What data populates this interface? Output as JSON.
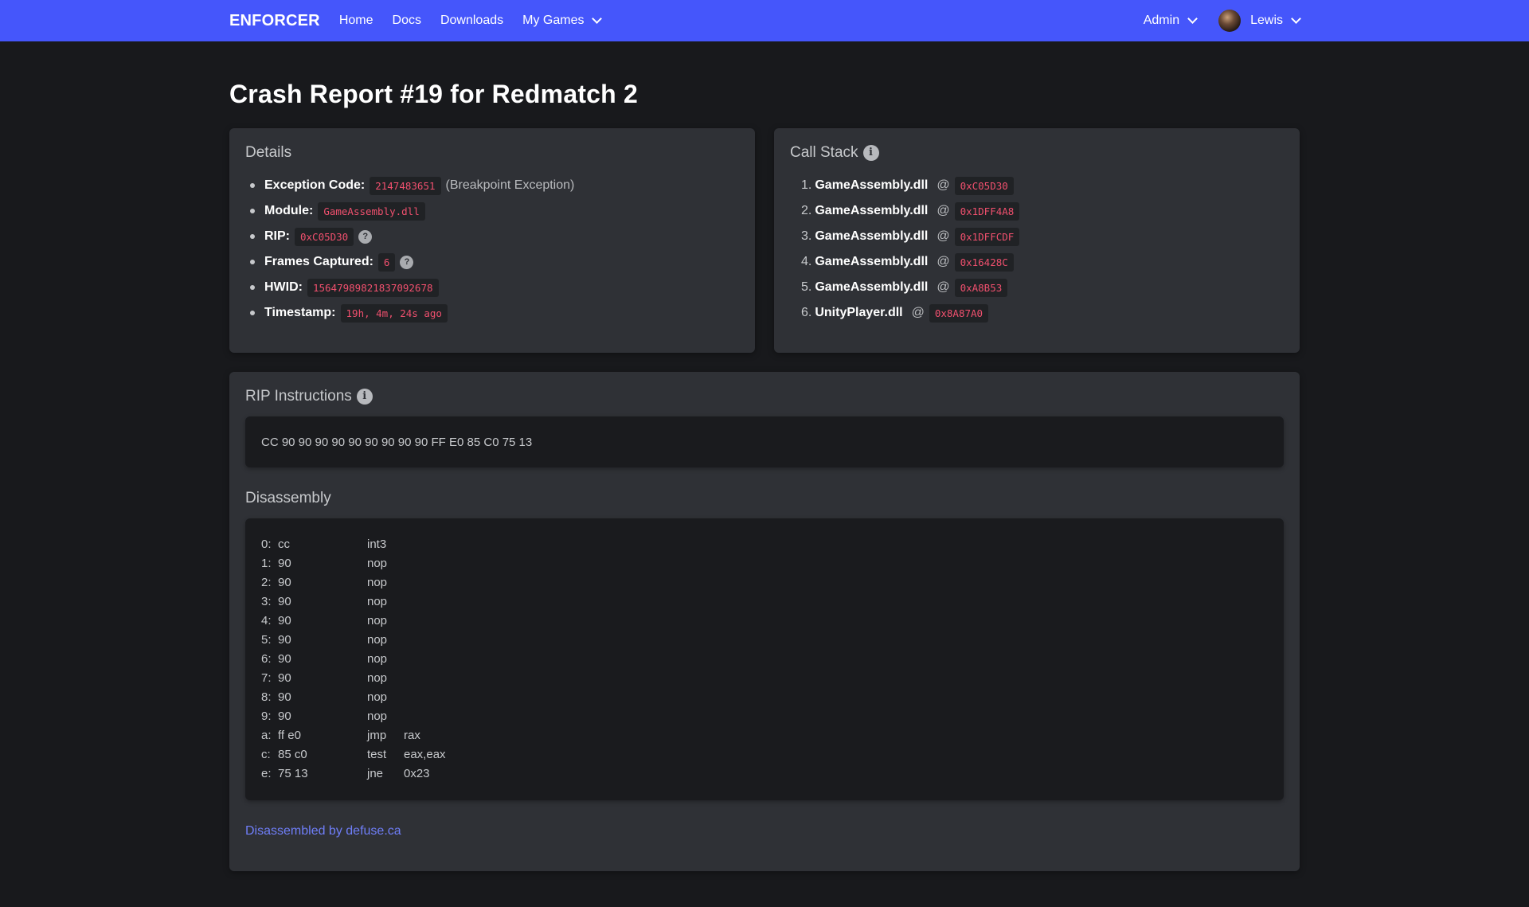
{
  "nav": {
    "brand": "ENFORCER",
    "links": [
      "Home",
      "Docs",
      "Downloads"
    ],
    "my_games": "My Games",
    "admin": "Admin",
    "user": "Lewis"
  },
  "page": {
    "title": "Crash Report #19 for Redmatch 2"
  },
  "details": {
    "title": "Details",
    "exception_label": "Exception Code:",
    "exception_value": "2147483651",
    "exception_desc": "(Breakpoint Exception)",
    "module_label": "Module:",
    "module_value": "GameAssembly.dll",
    "rip_label": "RIP:",
    "rip_value": "0xC05D30",
    "frames_label": "Frames Captured:",
    "frames_value": "6",
    "hwid_label": "HWID:",
    "hwid_value": "15647989821837092678",
    "timestamp_label": "Timestamp:",
    "timestamp_value": "19h, 4m, 24s ago"
  },
  "call_stack": {
    "title": "Call Stack",
    "at": "@",
    "frames": [
      {
        "num": "1.",
        "module": "GameAssembly.dll",
        "addr": "0xC05D30"
      },
      {
        "num": "2.",
        "module": "GameAssembly.dll",
        "addr": "0x1DFF4A8"
      },
      {
        "num": "3.",
        "module": "GameAssembly.dll",
        "addr": "0x1DFFCDF"
      },
      {
        "num": "4.",
        "module": "GameAssembly.dll",
        "addr": "0x16428C"
      },
      {
        "num": "5.",
        "module": "GameAssembly.dll",
        "addr": "0xA8B53"
      },
      {
        "num": "6.",
        "module": "UnityPlayer.dll",
        "addr": "0x8A87A0"
      }
    ]
  },
  "rip_instructions": {
    "title": "RIP Instructions",
    "hex": "CC 90 90 90 90 90 90 90 90 90 FF E0 85 C0 75 13"
  },
  "disassembly": {
    "title": "Disassembly",
    "lines": [
      {
        "addr": "0:",
        "bytes": "cc",
        "mnem": "int3",
        "ops": ""
      },
      {
        "addr": "1:",
        "bytes": "90",
        "mnem": "nop",
        "ops": ""
      },
      {
        "addr": "2:",
        "bytes": "90",
        "mnem": "nop",
        "ops": ""
      },
      {
        "addr": "3:",
        "bytes": "90",
        "mnem": "nop",
        "ops": ""
      },
      {
        "addr": "4:",
        "bytes": "90",
        "mnem": "nop",
        "ops": ""
      },
      {
        "addr": "5:",
        "bytes": "90",
        "mnem": "nop",
        "ops": ""
      },
      {
        "addr": "6:",
        "bytes": "90",
        "mnem": "nop",
        "ops": ""
      },
      {
        "addr": "7:",
        "bytes": "90",
        "mnem": "nop",
        "ops": ""
      },
      {
        "addr": "8:",
        "bytes": "90",
        "mnem": "nop",
        "ops": ""
      },
      {
        "addr": "9:",
        "bytes": "90",
        "mnem": "nop",
        "ops": ""
      },
      {
        "addr": "a:",
        "bytes": "ff e0",
        "mnem": "jmp",
        "ops": "rax"
      },
      {
        "addr": "c:",
        "bytes": "85 c0",
        "mnem": "test",
        "ops": "eax,eax"
      },
      {
        "addr": "e:",
        "bytes": "75 13",
        "mnem": "jne",
        "ops": "0x23"
      }
    ],
    "footer_link": "Disassembled by defuse.ca"
  },
  "icons": {
    "info": "info-icon",
    "help": "question-icon",
    "chevron": "chevron-down-icon"
  },
  "colors": {
    "navbar": "#4556fb",
    "background": "#18191c",
    "card": "#2f3136",
    "code_text": "#f0506e",
    "link": "#6f7ef8"
  }
}
